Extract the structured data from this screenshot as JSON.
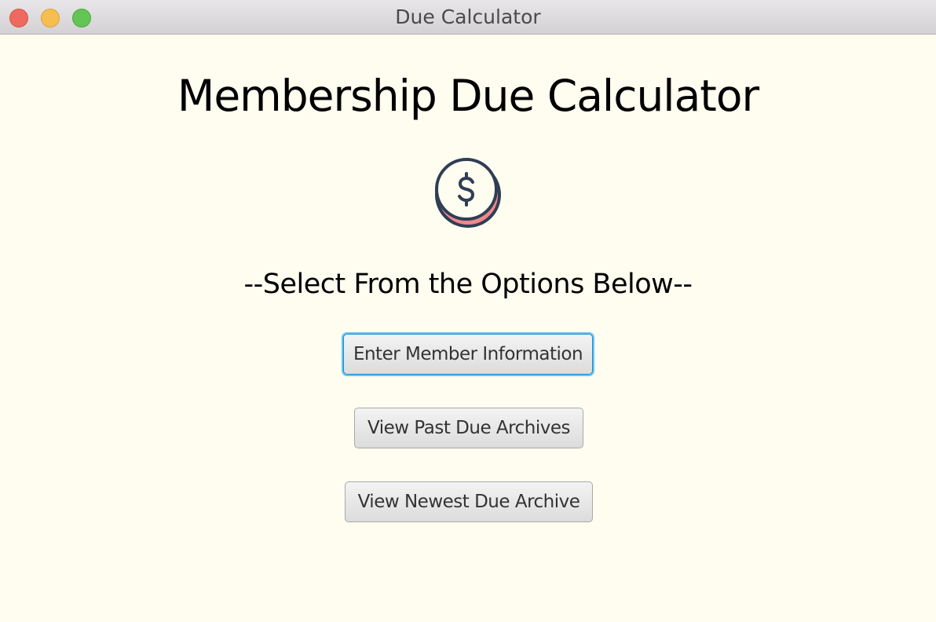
{
  "window": {
    "title": "Due Calculator"
  },
  "main": {
    "heading": "Membership Due Calculator",
    "coin_icon": "dollar-coin-icon",
    "subheading": "--Select From the Options Below--",
    "buttons": [
      {
        "label": "Enter Member Information",
        "focused": true
      },
      {
        "label": "View Past Due Archives",
        "focused": false
      },
      {
        "label": "View Newest Due Archive",
        "focused": false
      }
    ]
  },
  "colors": {
    "background": "#fffcf0",
    "focus_ring": "#0a8fd6",
    "coin_outline": "#2e3e55",
    "coin_accent": "#f0878a"
  }
}
